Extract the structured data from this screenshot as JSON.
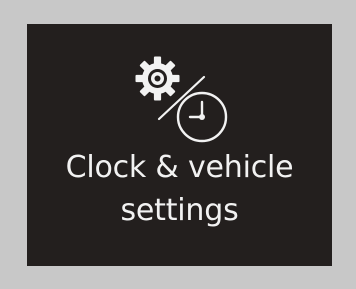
{
  "tile": {
    "label_line_1": "Clock & vehicle",
    "label_line_2": "settings",
    "icons": [
      "gear-icon",
      "clock-icon"
    ],
    "colors": {
      "background": "#231f1e",
      "foreground": "#f2f2f2",
      "frame": "#c8c8c8"
    }
  }
}
